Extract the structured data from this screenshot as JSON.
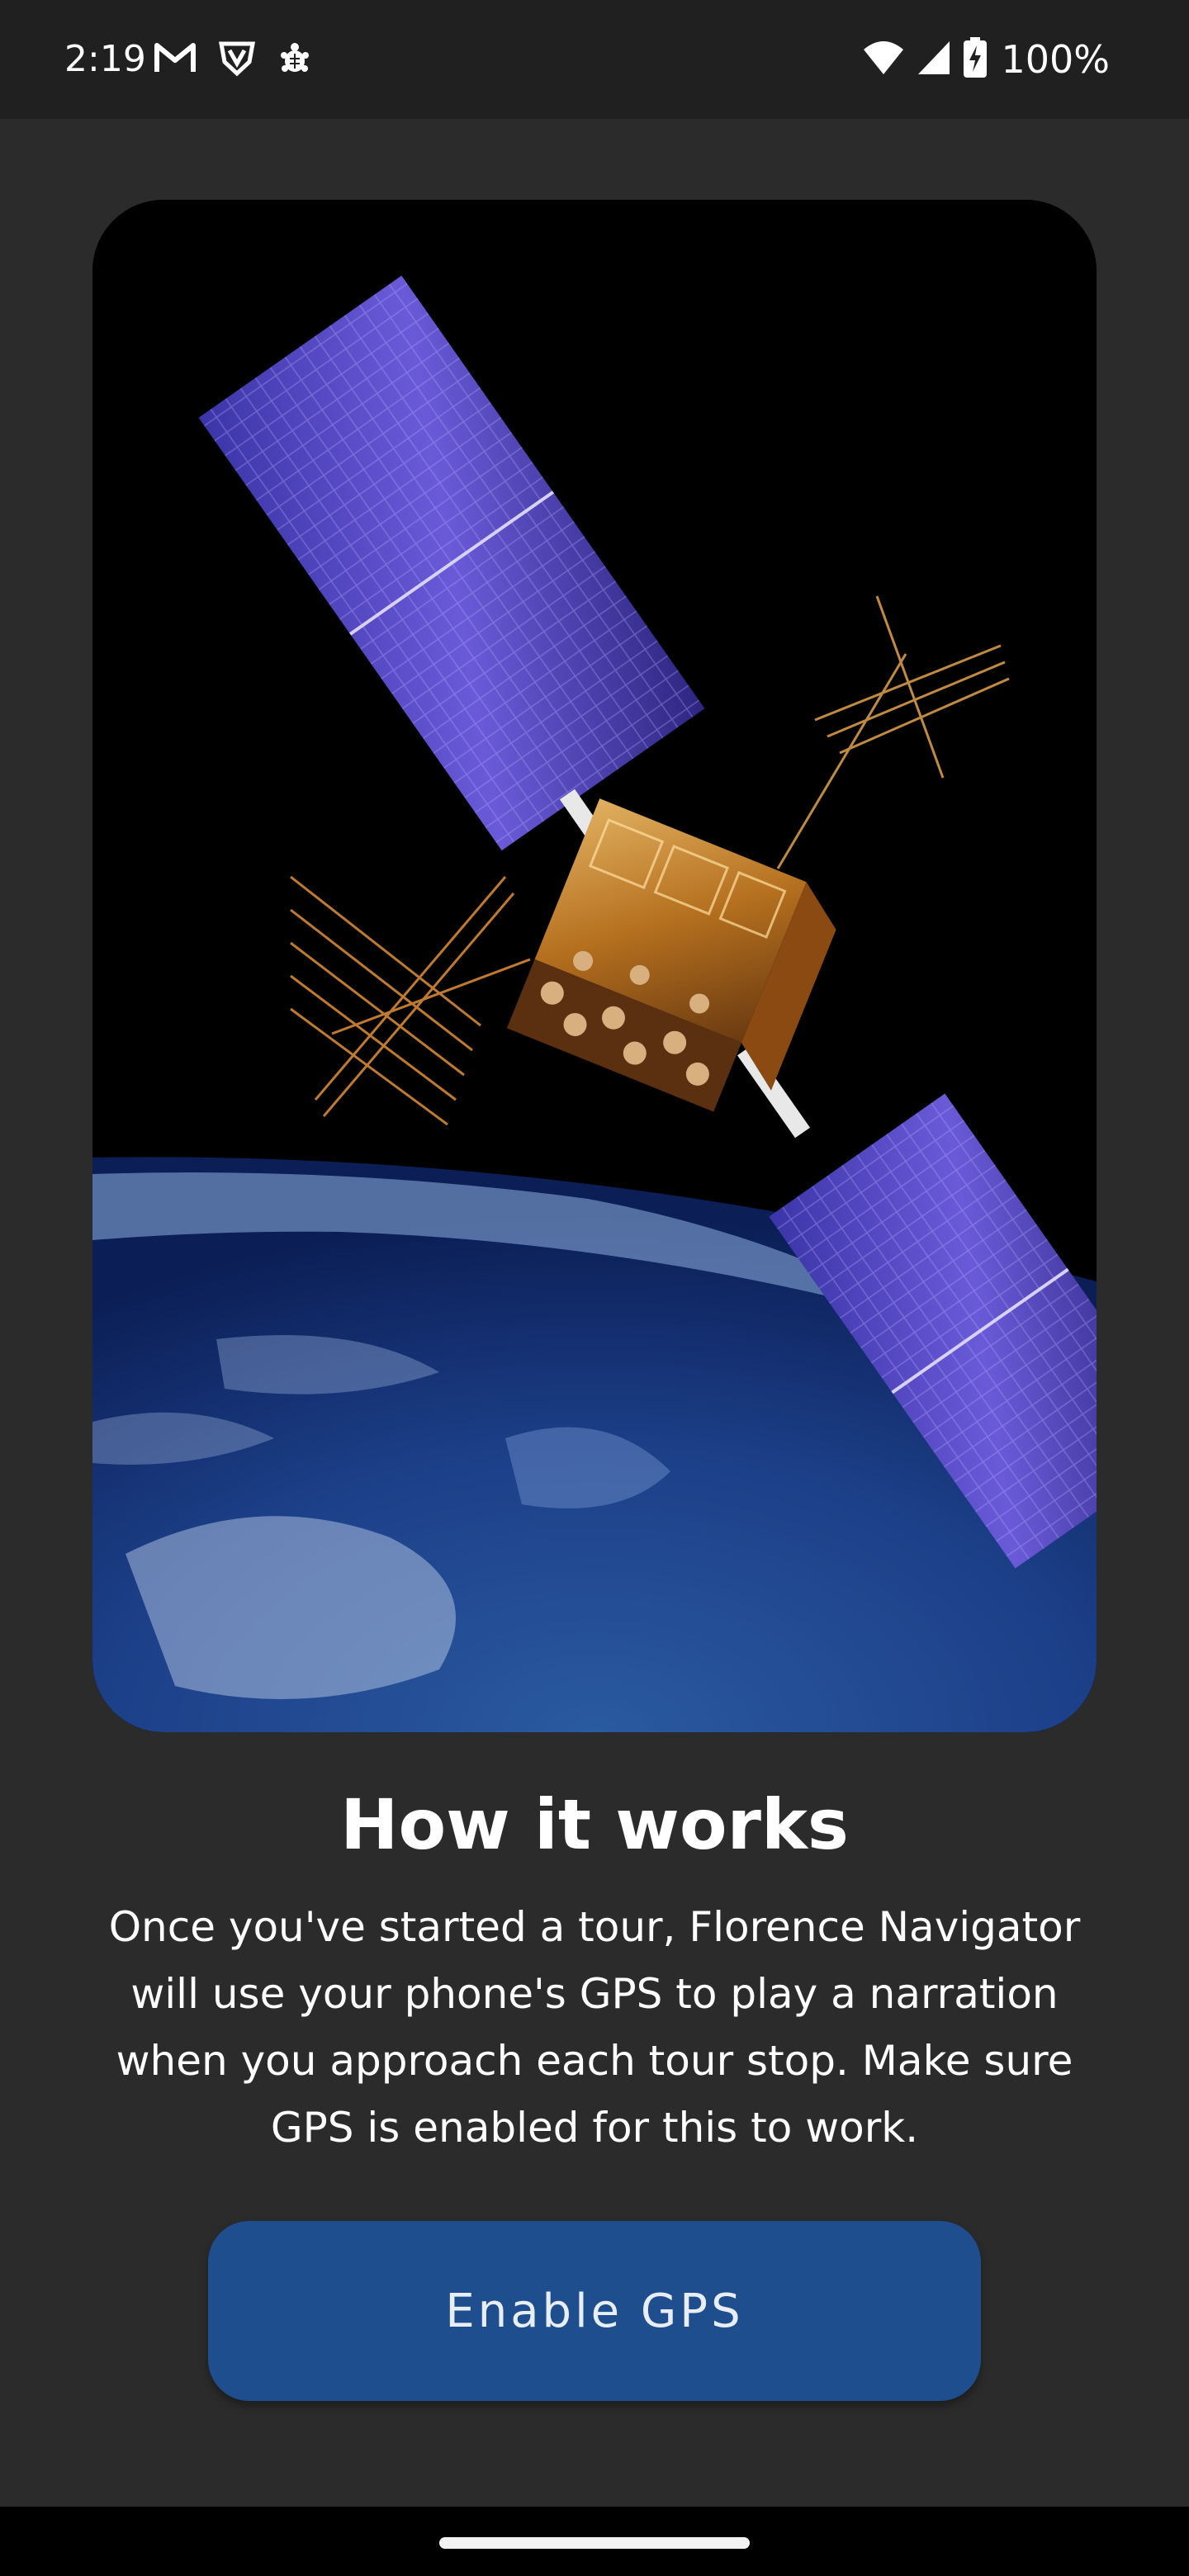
{
  "status_bar": {
    "time": "2:19",
    "left_icons": [
      "gmail-icon",
      "vpn-shield-icon",
      "turtle-icon"
    ],
    "right_icons": [
      "wifi-icon",
      "cellular-signal-icon",
      "battery-charging-icon"
    ],
    "battery_percent": "100%"
  },
  "hero": {
    "image": "gps-satellite-over-earth"
  },
  "content": {
    "title": "How it works",
    "description": "Once you've started a tour, Florence Navigator will use your phone's GPS to play a narration when you approach each tour stop. Make sure GPS is enabled for this to work."
  },
  "actions": {
    "enable_gps_label": "Enable GPS"
  },
  "colors": {
    "background": "#2b2b2b",
    "status_bar": "#202020",
    "button": "#1f4e8f",
    "text": "#ffffff"
  }
}
